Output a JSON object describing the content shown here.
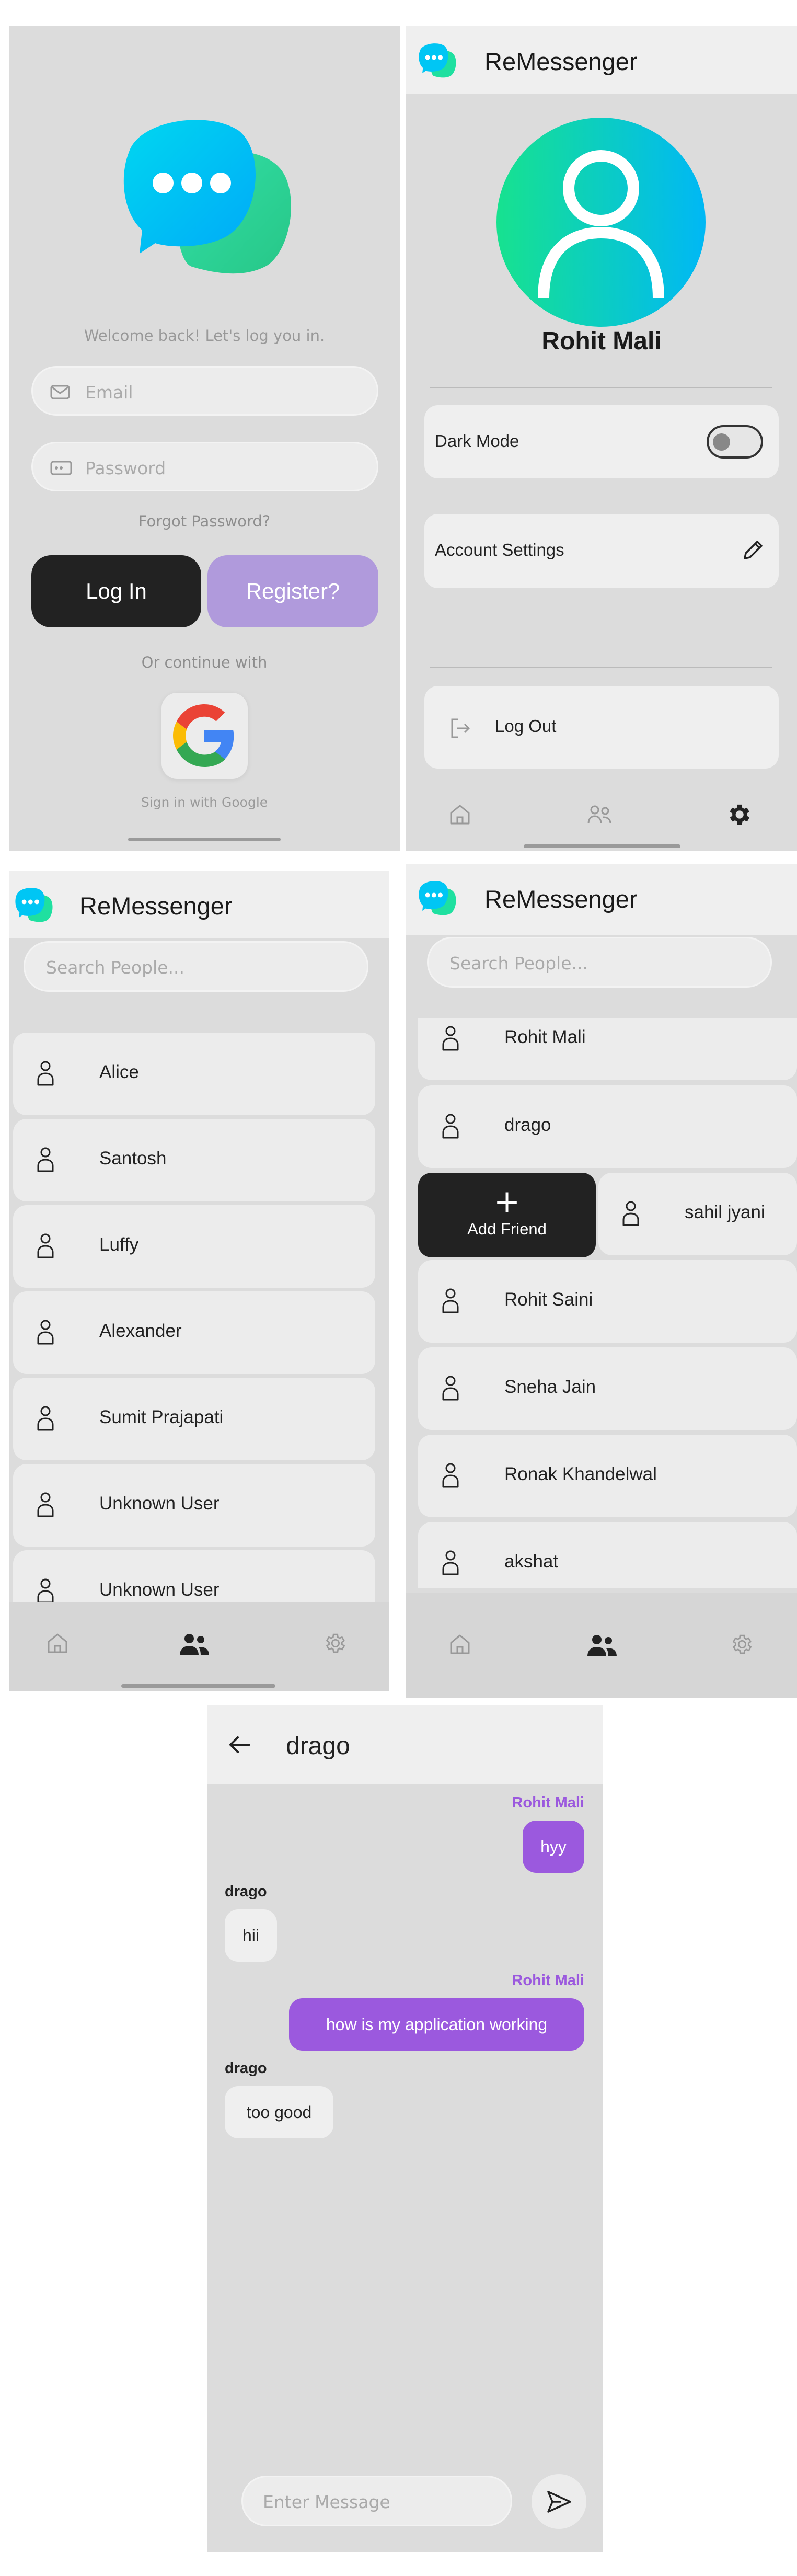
{
  "app": {
    "name": "ReMessenger"
  },
  "colors": {
    "accent": "#9b59de",
    "dark": "#222222",
    "register": "#b09adc",
    "background": "#dcdcdc"
  },
  "login": {
    "welcome": "Welcome back! Let's log you in.",
    "email_placeholder": "Email",
    "password_placeholder": "Password",
    "forgot": "Forgot Password?",
    "login_label": "Log In",
    "register_label": "Register?",
    "or_continue": "Or continue with",
    "google_label": "Sign in with Google"
  },
  "settings": {
    "title": "ReMessenger",
    "profile_name": "Rohit Mali",
    "dark_mode_label": "Dark Mode",
    "dark_mode_on": false,
    "account_settings_label": "Account Settings",
    "logout_label": "Log Out",
    "nav": [
      "home-icon",
      "users-icon",
      "gear-icon"
    ],
    "active_nav": "gear-icon"
  },
  "people": {
    "title": "ReMessenger",
    "search_placeholder": "Search People...",
    "users": [
      "Alice",
      "Santosh",
      "Luffy",
      "Alexander",
      "Sumit Prajapati",
      "Unknown User",
      "Unknown User"
    ],
    "active_nav": "users-icon"
  },
  "people_swipe": {
    "title": "ReMessenger",
    "search_placeholder": "Search People...",
    "users": [
      "Rohit Mali",
      "drago",
      "sahil jyani",
      "Rohit Saini",
      "Sneha Jain",
      "Ronak Khandelwal",
      "akshat"
    ],
    "add_friend_label": "Add Friend",
    "add_friend_plus": "+",
    "active_nav": "users-icon"
  },
  "chat": {
    "contact": "drago",
    "messages": [
      {
        "sender": "Rohit Mali",
        "text": "hyy",
        "mine": true
      },
      {
        "sender": "drago",
        "text": "hii",
        "mine": false
      },
      {
        "sender": "Rohit Mali",
        "text": "how is my application working",
        "mine": true
      },
      {
        "sender": "drago",
        "text": "too good",
        "mine": false
      }
    ],
    "input_placeholder": "Enter Message"
  }
}
